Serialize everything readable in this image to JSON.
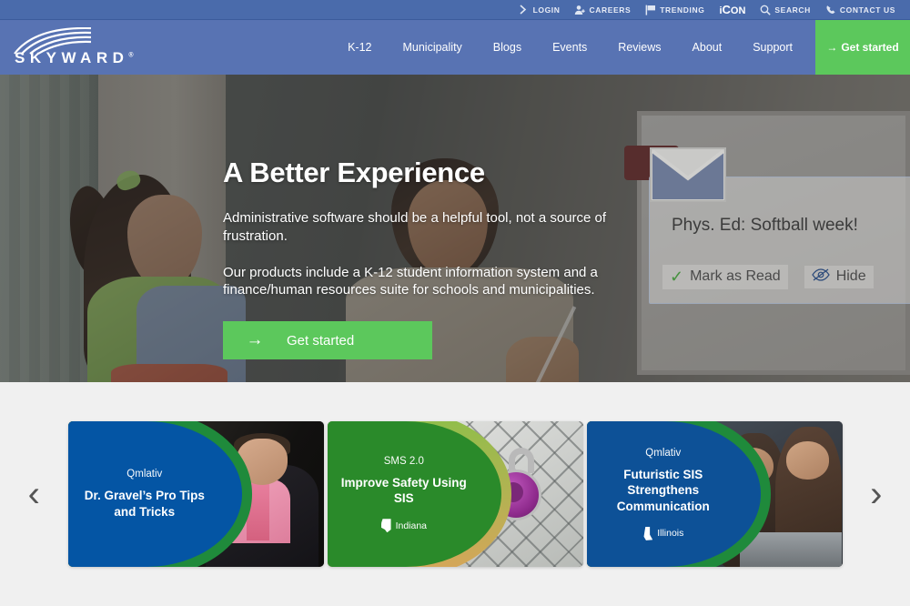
{
  "topbar": {
    "items": [
      {
        "icon": "chevron-right-icon",
        "label": "LOGIN"
      },
      {
        "icon": "user-icon",
        "label": "CAREERS"
      },
      {
        "icon": "flag-icon",
        "label": "TRENDING"
      },
      {
        "icon": "icon-logo",
        "label": "iCON"
      },
      {
        "icon": "search-icon",
        "label": "SEARCH"
      },
      {
        "icon": "phone-icon",
        "label": "CONTACT US"
      }
    ]
  },
  "header": {
    "logo_text": "SKYWARD",
    "logo_registered": "®",
    "nav": [
      {
        "label": "K-12"
      },
      {
        "label": "Municipality"
      },
      {
        "label": "Blogs"
      },
      {
        "label": "Events"
      },
      {
        "label": "Reviews"
      },
      {
        "label": "About"
      },
      {
        "label": "Support"
      }
    ],
    "cta_label": "Get started",
    "cta_arrow": "→"
  },
  "hero": {
    "title": "A Better Experience",
    "paragraph1": "Administrative software should be a helpful tool, not a source of frustration.",
    "paragraph2": "Our products include a K-12 student information system and a finance/human resources suite for schools and municipalities.",
    "button_label": "Get started",
    "button_arrow": "→",
    "notification": {
      "title": "Phys. Ed: Softball week!",
      "mark_as_read": "Mark as Read",
      "hide": "Hide",
      "check_glyph": "✓"
    }
  },
  "carousel": {
    "prev_glyph": "‹",
    "next_glyph": "›",
    "cards": [
      {
        "kicker": "Qmlativ",
        "title": "Dr. Gravel’s Pro Tips and Tricks",
        "state": "",
        "panel_color": "#0455a4",
        "arc_color": "#1f8a3b"
      },
      {
        "kicker": "SMS 2.0",
        "title": "Improve Safety Using SIS",
        "state": "Indiana",
        "panel_color": "#2a8a2a",
        "arc_color": "#d9a busy"
      },
      {
        "kicker": "Qmlativ",
        "title": "Futuristic SIS Strengthens Communication",
        "state": "Illinois",
        "panel_color": "#0d5197",
        "arc_color": "#1f8a3b"
      }
    ]
  },
  "colors": {
    "topbar_blue": "#4a6bab",
    "header_blue": "#5873b3",
    "accent_green": "#5cc85c",
    "card_blue": "#0455a4",
    "card_green": "#2a8a2a",
    "section_bg": "#f0f0f0"
  }
}
